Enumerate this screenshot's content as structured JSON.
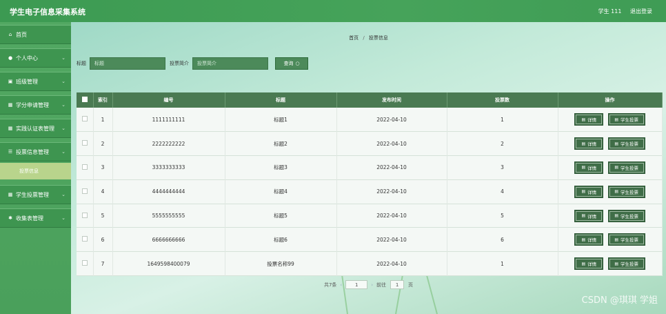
{
  "header": {
    "title": "学生电子信息采集系统",
    "user": "学生 111",
    "logout": "退出登录"
  },
  "sidebar": {
    "items": [
      {
        "icon": "home-icon",
        "glyph": "⌂",
        "label": "首页",
        "has_chevron": false
      },
      {
        "icon": "user-icon",
        "glyph": "●",
        "label": "个人中心",
        "has_chevron": true
      },
      {
        "icon": "class-icon",
        "glyph": "▣",
        "label": "班级管理",
        "has_chevron": true
      },
      {
        "icon": "grid-icon",
        "glyph": "▦",
        "label": "学分申请管理",
        "has_chevron": true
      },
      {
        "icon": "grid-icon",
        "glyph": "▦",
        "label": "实践认证表管理",
        "has_chevron": true
      },
      {
        "icon": "list-icon",
        "glyph": "☰",
        "label": "投票信息管理",
        "has_chevron": true
      },
      {
        "icon": "grid-icon",
        "glyph": "▦",
        "label": "学生投票管理",
        "has_chevron": true
      },
      {
        "icon": "collection-icon",
        "glyph": "✱",
        "label": "收集表管理",
        "has_chevron": true
      }
    ],
    "active_sub": "投票信息"
  },
  "breadcrumb": {
    "home": "首页",
    "sep": "/",
    "current": "投票信息"
  },
  "search": {
    "title_label": "标题",
    "title_placeholder": "标题",
    "intro_label": "投票简介",
    "intro_placeholder": "投票简介",
    "button": "查询",
    "button_glyph": "○"
  },
  "table": {
    "columns": [
      "索引",
      "编号",
      "标题",
      "发布时间",
      "投票数",
      "操作"
    ],
    "rows": [
      {
        "index": "1",
        "code": "1111111111",
        "title": "标题1",
        "date": "2022-04-10",
        "votes": "1"
      },
      {
        "index": "2",
        "code": "2222222222",
        "title": "标题2",
        "date": "2022-04-10",
        "votes": "2"
      },
      {
        "index": "3",
        "code": "3333333333",
        "title": "标题3",
        "date": "2022-04-10",
        "votes": "3"
      },
      {
        "index": "4",
        "code": "4444444444",
        "title": "标题4",
        "date": "2022-04-10",
        "votes": "4"
      },
      {
        "index": "5",
        "code": "5555555555",
        "title": "标题5",
        "date": "2022-04-10",
        "votes": "5"
      },
      {
        "index": "6",
        "code": "6666666666",
        "title": "标题6",
        "date": "2022-04-10",
        "votes": "6"
      },
      {
        "index": "7",
        "code": "1649598400079",
        "title": "投票名称99",
        "date": "2022-04-10",
        "votes": "1"
      }
    ],
    "detail_label": "详情",
    "vote_label": "学生投票",
    "btn_glyph": "▤"
  },
  "pager": {
    "prefix": "共7条",
    "prev": "‹",
    "page": "1",
    "next": "›",
    "goto": "前往",
    "goto_page": "1",
    "suffix": "页"
  },
  "watermark": "CSDN @琪琪 学姐"
}
